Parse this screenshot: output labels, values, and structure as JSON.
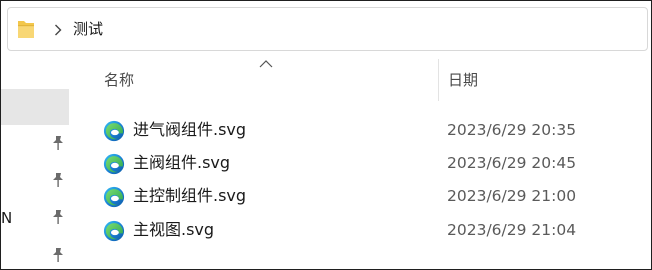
{
  "address_bar": {
    "folder_icon": "folder-icon",
    "separator_icon": "chevron-right-icon",
    "breadcrumb": "测试"
  },
  "navigation_pane": {
    "pin_icon": "pin-icon",
    "pinned_count": 4,
    "partial_label": "N"
  },
  "columns": {
    "name": "名称",
    "date": "日期",
    "sort_indicator": "sort-ascending-icon"
  },
  "files": [
    {
      "name": "进气阀组件.svg",
      "date": "2023/6/29 20:35",
      "icon": "edge-svg-file-icon"
    },
    {
      "name": "主阀组件.svg",
      "date": "2023/6/29 20:45",
      "icon": "edge-svg-file-icon"
    },
    {
      "name": "主控制组件.svg",
      "date": "2023/6/29 21:00",
      "icon": "edge-svg-file-icon"
    },
    {
      "name": "主视图.svg",
      "date": "2023/6/29 21:04",
      "icon": "edge-svg-file-icon"
    }
  ],
  "colors": {
    "folder": "#f3c74b",
    "edge_blue": "#1a7fd4",
    "edge_green": "#4cc35a",
    "selection": "#e6e6e6",
    "date_text": "#5a5a5a"
  }
}
